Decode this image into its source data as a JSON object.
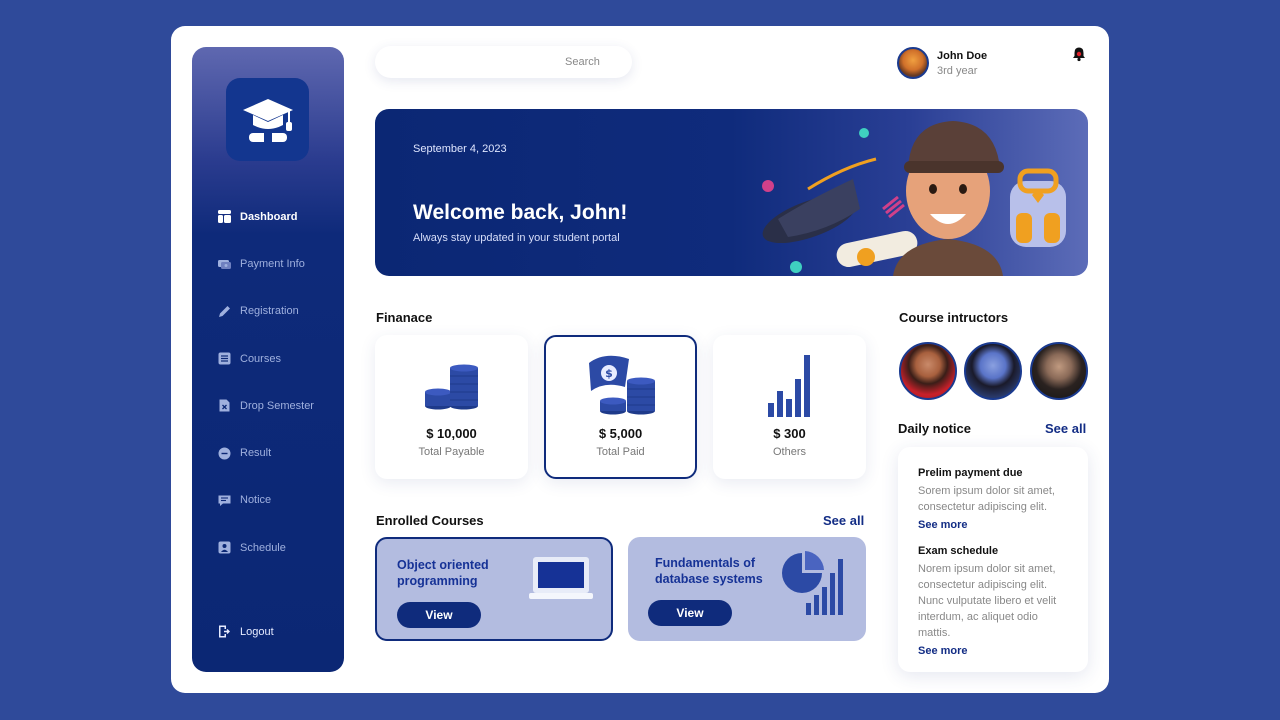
{
  "sidebar": {
    "items": [
      {
        "label": "Dashboard",
        "icon": "dashboard-icon"
      },
      {
        "label": "Payment Info",
        "icon": "payment-icon"
      },
      {
        "label": "Registration",
        "icon": "pencil-icon"
      },
      {
        "label": "Courses",
        "icon": "courses-icon"
      },
      {
        "label": "Drop Semester",
        "icon": "drop-icon"
      },
      {
        "label": "Result",
        "icon": "result-icon"
      },
      {
        "label": "Notice",
        "icon": "notice-icon"
      },
      {
        "label": "Schedule",
        "icon": "schedule-icon"
      }
    ],
    "logout": "Logout"
  },
  "search": {
    "placeholder": "Search"
  },
  "user": {
    "name": "John Doe",
    "year": "3rd year"
  },
  "banner": {
    "date": "September 4,  2023",
    "title": "Welcome back, John!",
    "subtitle": "Always stay updated in your student portal"
  },
  "finance": {
    "title": "Finanace",
    "cards": [
      {
        "amount": "$ 10,000",
        "label": "Total Payable"
      },
      {
        "amount": "$ 5,000",
        "label": "Total Paid"
      },
      {
        "amount": "$ 300",
        "label": "Others"
      }
    ]
  },
  "courses": {
    "title": "Enrolled Courses",
    "see_all": "See all",
    "items": [
      {
        "title": "Object oriented programming",
        "button": "View"
      },
      {
        "title": "Fundamentals of database systems",
        "button": "View"
      }
    ]
  },
  "instructors": {
    "title": "Course intructors"
  },
  "notices": {
    "title": "Daily notice",
    "see_all": "See all",
    "items": [
      {
        "title": "Prelim payment due",
        "body": "Sorem ipsum dolor sit amet, consectetur adipiscing elit.",
        "more": "See more"
      },
      {
        "title": "Exam schedule",
        "body": "Norem ipsum dolor sit amet, consectetur adipiscing elit. Nunc vulputate libero et velit interdum, ac aliquet odio mattis.",
        "more": "See more"
      }
    ]
  },
  "colors": {
    "background": "#2f4a9a",
    "primary": "#0f2b7c",
    "accent": "#132d85",
    "course_card": "#b3bce0"
  }
}
